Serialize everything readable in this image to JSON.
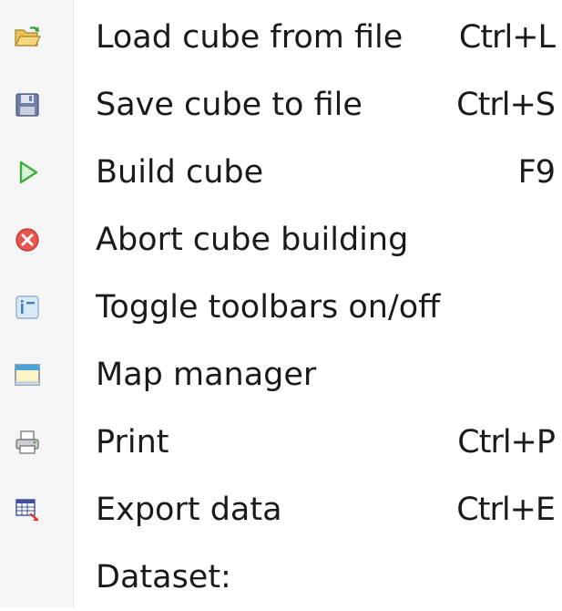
{
  "menu": {
    "items": [
      {
        "icon": "open-folder-icon",
        "label": "Load cube from file",
        "shortcut": "Ctrl+L"
      },
      {
        "icon": "save-disk-icon",
        "label": "Save cube to file",
        "shortcut": "Ctrl+S"
      },
      {
        "icon": "play-triangle-icon",
        "label": "Build cube",
        "shortcut": "F9"
      },
      {
        "icon": "abort-cross-icon",
        "label": "Abort cube building",
        "shortcut": ""
      },
      {
        "icon": "toolbar-toggle-icon",
        "label": "Toggle toolbars on/off",
        "shortcut": ""
      },
      {
        "icon": "window-icon",
        "label": "Map manager",
        "shortcut": ""
      },
      {
        "icon": "printer-icon",
        "label": "Print",
        "shortcut": "Ctrl+P"
      },
      {
        "icon": "export-grid-icon",
        "label": "Export data",
        "shortcut": "Ctrl+E"
      },
      {
        "icon": "",
        "label": "Dataset:",
        "shortcut": ""
      }
    ]
  },
  "colors": {
    "gutter": "#f5f5f5",
    "text": "#1a1a1a",
    "play_green": "#3fae3f",
    "abort_red": "#e8554e"
  }
}
